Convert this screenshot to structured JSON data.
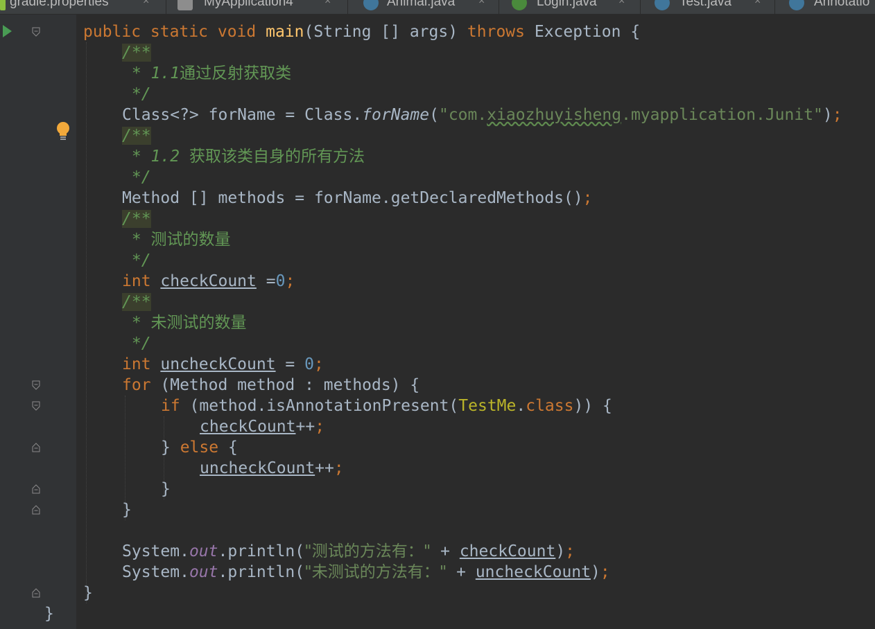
{
  "tabs": [
    {
      "label": "gradle.properties",
      "icon": "gradle-icon"
    },
    {
      "label": "MyApplication4",
      "icon": "module-icon"
    },
    {
      "label": "Animal.java",
      "icon": "class-icon"
    },
    {
      "label": "Login.java",
      "icon": "activity-class-icon"
    },
    {
      "label": "Test.java",
      "icon": "class-icon"
    },
    {
      "label": "Annotatio",
      "icon": "class-icon"
    }
  ],
  "tab_close": "×",
  "colors": {
    "background": "#2b2b2b",
    "keyword": "#cc7832",
    "string": "#6a8759",
    "comment": "#629755",
    "number": "#6897bb",
    "method": "#ffc66d",
    "static_field": "#9876aa",
    "annotation": "#bbb529"
  },
  "code": {
    "l1": {
      "a": "public static void ",
      "b": "main",
      "c": "(String [] args) ",
      "d": "throws ",
      "e": "Exception {"
    },
    "l2": {
      "a": "/**"
    },
    "l3": {
      "a": " * ",
      "b": "1.1",
      "c": "通过反射获取类"
    },
    "l4": {
      "a": " */"
    },
    "l5": {
      "a": "Class<?> forName = Class.",
      "b": "forName",
      "c": "(",
      "d": "\"com.",
      "e": "xiaozhuyisheng",
      "f": ".myapplication.Junit\"",
      "g": ")",
      "h": ";"
    },
    "l6": {
      "a": "/**"
    },
    "l7": {
      "a": " * ",
      "b": "1.2 ",
      "c": "获取该类自身的所有方法"
    },
    "l8": {
      "a": " */"
    },
    "l9": {
      "a": "Method [] methods = forName.getDeclaredMethods()",
      "b": ";"
    },
    "l10": {
      "a": "/**"
    },
    "l11": {
      "a": " * ",
      "c": "测试的数量"
    },
    "l12": {
      "a": " */"
    },
    "l13": {
      "a": "int ",
      "b": "checkCount",
      "c": " =",
      "d": "0",
      "e": ";"
    },
    "l14": {
      "a": "/**"
    },
    "l15": {
      "a": " * ",
      "c": "未测试的数量"
    },
    "l16": {
      "a": " */"
    },
    "l17": {
      "a": "int ",
      "b": "uncheckCount",
      "c": " = ",
      "d": "0",
      "e": ";"
    },
    "l18": {
      "a": "for ",
      "b": "(Method method : methods) {"
    },
    "l19": {
      "a": "if ",
      "b": "(method.isAnnotationPresent(",
      "c": "TestMe",
      "d": ".",
      "e": "class",
      "f": ")) {"
    },
    "l20": {
      "a": "checkCount",
      "b": "++",
      "c": ";"
    },
    "l21": {
      "a": "} ",
      "b": "else ",
      "c": "{"
    },
    "l22": {
      "a": "uncheckCount",
      "b": "++",
      "c": ";"
    },
    "l23": {
      "a": "}"
    },
    "l24": {
      "a": "}"
    },
    "l26": {
      "a": "System.",
      "b": "out",
      "c": ".println(",
      "d": "\"测试的方法有：\"",
      "e": " + ",
      "f": "checkCount",
      "g": ")",
      "h": ";"
    },
    "l27": {
      "a": "System.",
      "b": "out",
      "c": ".println(",
      "d": "\"未测试的方法有：\"",
      "e": " + ",
      "f": "uncheckCount",
      "g": ")",
      "h": ";"
    },
    "l28": {
      "a": "}"
    },
    "l29": {
      "a": "}"
    }
  }
}
